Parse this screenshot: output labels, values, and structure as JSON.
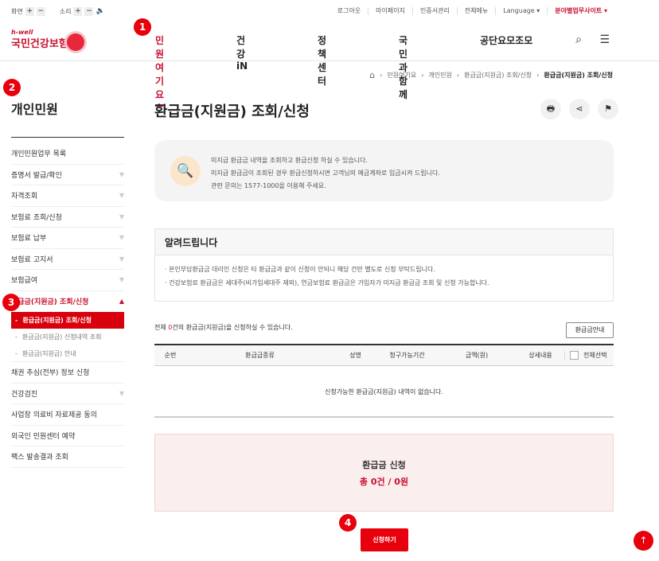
{
  "util": {
    "screen_label": "화면",
    "sound_label": "소리",
    "plus": "+",
    "minus": "−",
    "speaker_glyph": "🔈",
    "links": [
      "로그아웃",
      "마이페이지",
      "인증서관리",
      "전체메뉴"
    ],
    "language": "Language",
    "sites": "분야별업무사이트",
    "dropdown_glyph": "▾"
  },
  "logo": {
    "top": "h-well",
    "bottom": "국민건강보험"
  },
  "gnb": [
    "민원여기요",
    "건강iN",
    "정책센터",
    "국민과함께",
    "공단요모조모"
  ],
  "header_icons": {
    "search": "⌕",
    "menu": "☰"
  },
  "breadcrumb": {
    "home_glyph": "⌂",
    "sep": "›",
    "items": [
      "민원여기요",
      "개인민원",
      "환급금(지원금) 조회/신청",
      "환급금(지원금) 조회/신청"
    ]
  },
  "sidebar": {
    "title": "개인민원",
    "items": [
      {
        "label": "개인민원업무 목록",
        "chev": ""
      },
      {
        "label": "증명서 발급/확인",
        "chev": "▼"
      },
      {
        "label": "자격조회",
        "chev": "▼"
      },
      {
        "label": "보험료 조회/신청",
        "chev": "▼"
      },
      {
        "label": "보험료 납부",
        "chev": "▼"
      },
      {
        "label": "보험료 고지서",
        "chev": "▼"
      },
      {
        "label": "보험급여",
        "chev": "▼"
      },
      {
        "label": "환급금(지원금) 조회/신청",
        "chev": "▲"
      }
    ],
    "subitems": [
      "환급금(지원금) 조회/신청",
      "환급금(지원금) 신청내역 조회",
      "환급금(지원금) 안내"
    ],
    "sub_marker": "-",
    "items2": [
      {
        "label": "채권 추심(전부) 정보 신청",
        "chev": ""
      },
      {
        "label": "건강검진",
        "chev": "▼"
      },
      {
        "label": "사업장 의료비 자료제공 동의",
        "chev": ""
      },
      {
        "label": "외국인 민원센터 예약",
        "chev": ""
      },
      {
        "label": "팩스 발송결과 조회",
        "chev": ""
      }
    ]
  },
  "badges": [
    "1",
    "2",
    "3",
    "4"
  ],
  "page": {
    "title": "환급금(지원금) 조회/신청",
    "tools": [
      "🖶",
      "⋖",
      "⚑"
    ]
  },
  "info": {
    "icon": "🔍",
    "lines": [
      "미지급 환급금 내역을 조회하고 환급신청 하실 수 있습니다.",
      "미지급 환급금이 조회된 경우 환급신청하시면 고객님의 예금계좌로 입금시켜 드립니다.",
      "관련 문의는 1577-1000을 이용해 주세요."
    ]
  },
  "notice": {
    "title": "알려드립니다",
    "lines": [
      "· 본인부담환급금 대리인 신청은 타 환급금과 같이 신청이 안되니 해당 건만 별도로 신청 부탁드립니다.",
      "· 건강보험료 환급금은 세대주(비가입세대주 제외), 연금보험료 환급금은 가입자가 미지급 환급금 조회 및 신청 가능합니다."
    ]
  },
  "count": {
    "prefix": "전체 ",
    "num": "0",
    "suffix": "건의 환급금(지원금)을 신청하실 수 있습니다."
  },
  "guide_button": "환급금안내",
  "table": {
    "headers": [
      "순번",
      "환급금종류",
      "성명",
      "청구가능기간",
      "금액(원)",
      "상세내용",
      "전체선택"
    ],
    "empty": "신청가능한 환급금(지원금) 내역이 없습니다."
  },
  "summary": {
    "label": "환급금 신청",
    "value": "총 0건 / 0원"
  },
  "apply_button": "신청하기",
  "top_button": "↑",
  "colors": {
    "accent": "#e8000c",
    "brand": "#c8102e"
  }
}
